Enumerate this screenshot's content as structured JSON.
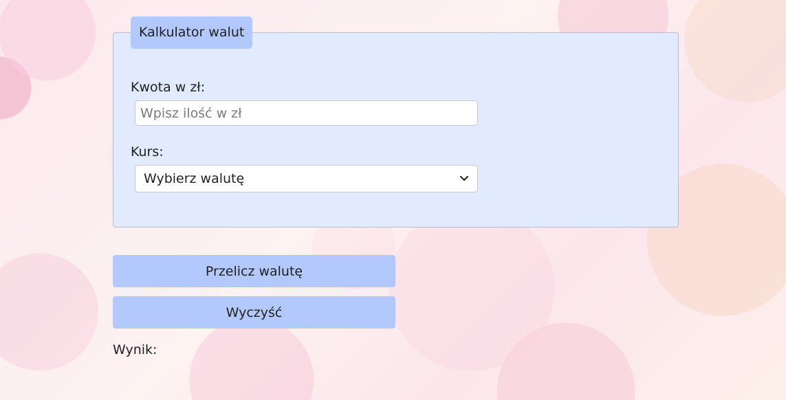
{
  "calculator": {
    "legend": "Kalkulator walut",
    "amount_label": "Kwota w zł:",
    "amount_value": "",
    "amount_placeholder": "Wpisz ilość w zł",
    "rate_label": "Kurs:",
    "rate_selected": "Wybierz walutę"
  },
  "actions": {
    "convert_label": "Przelicz walutę",
    "clear_label": "Wyczyść"
  },
  "result": {
    "label": "Wynik:",
    "value": ""
  },
  "icons": {
    "select_arrow": "chevron-down-icon"
  },
  "colors": {
    "panel_background": "#e2ebfd",
    "button_background": "#b3c9fd",
    "text": "#1f1f1f"
  }
}
